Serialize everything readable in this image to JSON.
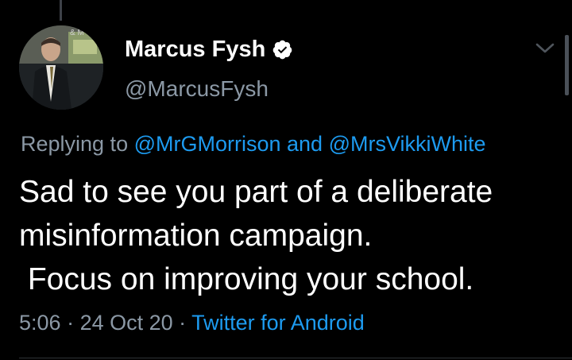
{
  "tweet": {
    "author": {
      "display_name": "Marcus Fysh",
      "handle": "@MarcusFysh",
      "verified": true,
      "avatar_icon": "profile-photo-icon"
    },
    "reply_context": {
      "prefix": "Replying to ",
      "mention_1": "@MrGMorrison",
      "conjunction": " and ",
      "mention_2": "@MrsVikkiWhite"
    },
    "text": "Sad to see you part of a deliberate\nmisinformation campaign.\n Focus on improving your school.",
    "time": "5:06",
    "separator": " · ",
    "date": "24 Oct 20",
    "source": "Twitter for Android",
    "menu_icon": "chevron-down-icon"
  },
  "colors": {
    "background": "#000000",
    "primary_text": "#ffffff",
    "secondary_text": "#8b98a5",
    "accent": "#1d9bf0"
  }
}
